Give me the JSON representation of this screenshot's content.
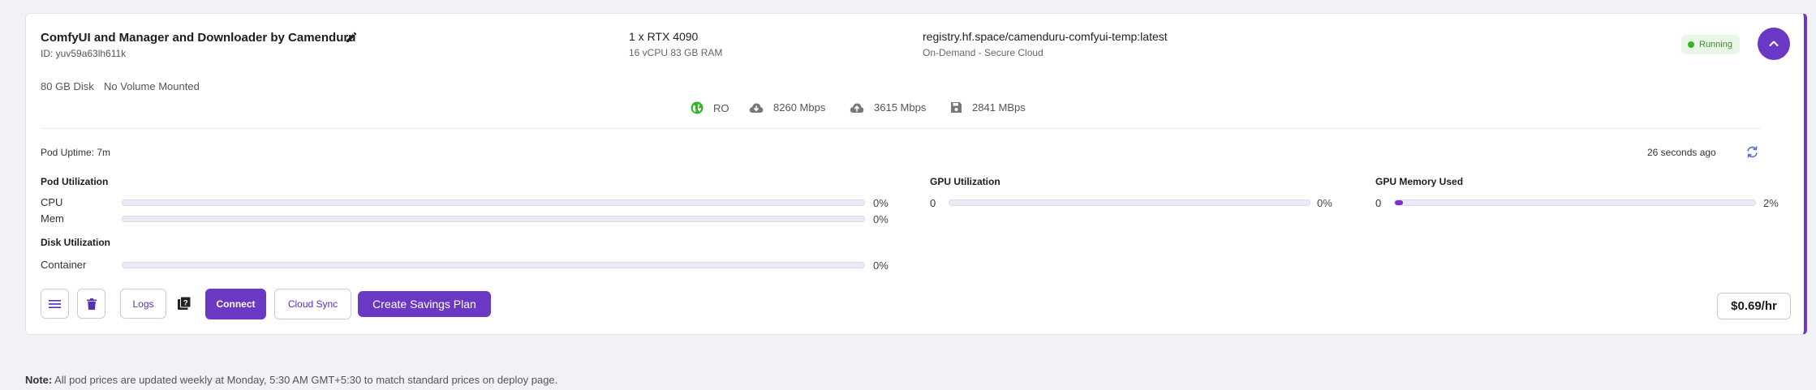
{
  "pod": {
    "name": "ComfyUI and Manager and Downloader by Camenduru",
    "id": "ID: yuv59a63lh611k",
    "gpu": "1 x RTX 4090",
    "specs": "16 vCPU 83 GB RAM",
    "image": "registry.hf.space/camenduru-comfyui-temp:latest",
    "cloud": "On-Demand - Secure Cloud",
    "status": "Running",
    "disk": "80 GB Disk",
    "volume": "No Volume Mounted"
  },
  "stats": {
    "region": "RO",
    "download": "8260 Mbps",
    "upload": "3615 Mbps",
    "disk_speed": "2841 MBps"
  },
  "telemetry": {
    "uptime": "Pod Uptime: 7m",
    "updated": "26 seconds ago",
    "pod_utilization": {
      "title": "Pod Utilization",
      "cpu_label": "CPU",
      "cpu_pct": "0%",
      "cpu_value": 0,
      "mem_label": "Mem",
      "mem_pct": "0%",
      "mem_value": 0
    },
    "disk_utilization": {
      "title": "Disk Utilization",
      "container_label": "Container",
      "container_pct": "0%",
      "container_value": 0
    },
    "gpu_utilization": {
      "title": "GPU Utilization",
      "index": "0",
      "pct": "0%",
      "value": 0
    },
    "gpu_memory": {
      "title": "GPU Memory Used",
      "index": "0",
      "pct": "2%",
      "value": 0.02
    }
  },
  "actions": {
    "logs": "Logs",
    "connect": "Connect",
    "cloud_sync": "Cloud Sync",
    "savings_plan": "Create Savings Plan",
    "price": "$0.69/hr"
  },
  "note": {
    "label": "Note:",
    "text": "All pod prices are updated weekly at Monday, 5:30 AM GMT+5:30 to match standard prices on deploy page."
  },
  "icons": {
    "edit": "pencil-icon",
    "collapse": "chevron-up-icon",
    "region": "globe-icon",
    "download": "cloud-download-icon",
    "upload": "cloud-upload-icon",
    "disk": "floppy-disk-icon",
    "refresh": "refresh-icon",
    "menu": "hamburger-menu-icon",
    "delete": "trash-icon",
    "help": "help-book-icon"
  },
  "colors": {
    "accent": "#6a38c2",
    "running_bg": "#e8f7e6",
    "running_text": "#3d8d2b",
    "bar_fill": "#7b2fd0"
  }
}
